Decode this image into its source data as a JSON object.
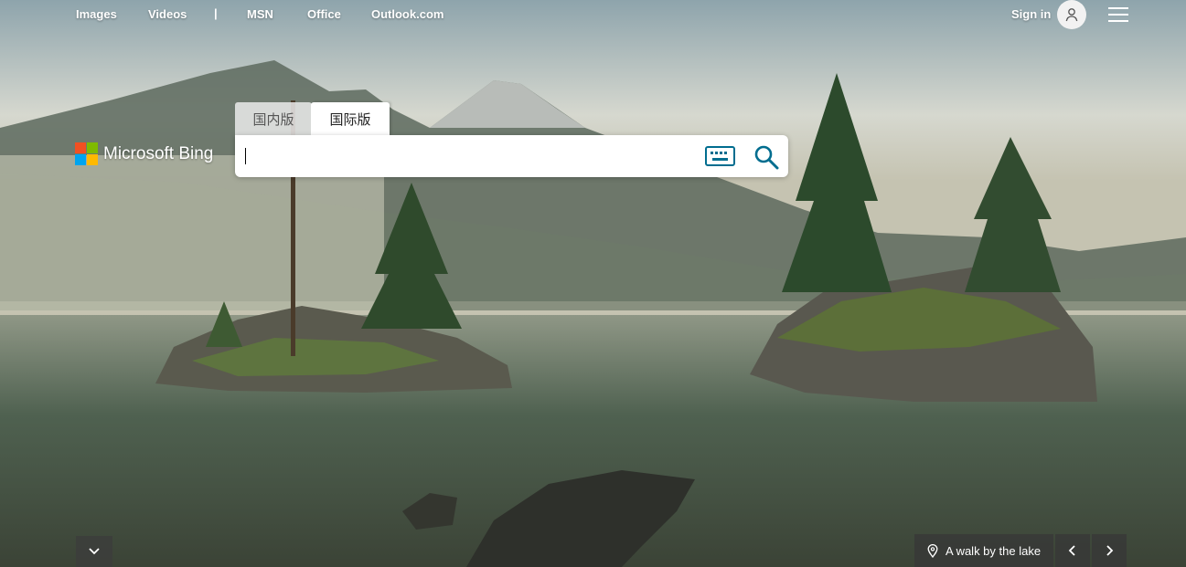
{
  "nav": {
    "links": [
      "Images",
      "Videos",
      "MSN",
      "Office",
      "Outlook.com"
    ],
    "separator": "|",
    "sign_in": "Sign in"
  },
  "logo": {
    "text": "Microsoft Bing",
    "colors": [
      "#f25022",
      "#7fba00",
      "#00a4ef",
      "#ffb900"
    ]
  },
  "tabs": [
    {
      "label": "国内版",
      "active": false
    },
    {
      "label": "国际版",
      "active": true
    }
  ],
  "search": {
    "value": "",
    "placeholder": "",
    "accent": "#006d8f"
  },
  "image_caption": "A walk by the lake",
  "icons": {
    "avatar": "user-icon",
    "menu": "hamburger-menu-icon",
    "keyboard": "keyboard-icon",
    "search": "search-icon",
    "scroll": "chevron-down-icon",
    "location": "location-pin-icon",
    "prev": "chevron-left-icon",
    "next": "chevron-right-icon"
  }
}
